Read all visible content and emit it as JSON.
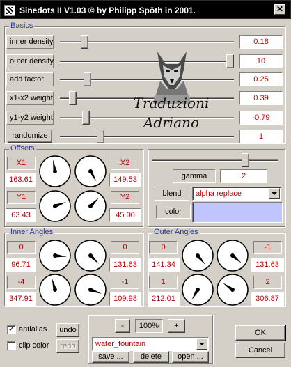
{
  "window": {
    "title": "Sinedots II V1.03 © by Philipp Spöth in 2001.",
    "close_glyph": "✕"
  },
  "logo": {
    "line1": "Traduzioni",
    "line2": "Adriano"
  },
  "basics": {
    "legend": "Basics",
    "rows": [
      {
        "label": "inner density",
        "value": "0.18",
        "level": 0.12
      },
      {
        "label": "outer density",
        "value": "10",
        "level": 1.0
      },
      {
        "label": "add factor",
        "value": "0.25",
        "level": 0.14
      },
      {
        "label": "x1-x2 weight",
        "value": "0.39",
        "level": 0.05
      },
      {
        "label": "y1-y2 weight",
        "value": "-0.79",
        "level": 0.13
      }
    ],
    "randomize_label": "randomize",
    "randomize_value": "1",
    "randomize_level": 0.22
  },
  "offsets": {
    "legend": "Offsets",
    "x1": {
      "label": "X1",
      "value": "163.61"
    },
    "x2": {
      "label": "X2",
      "value": "149.53"
    },
    "y1": {
      "label": "Y1",
      "value": "63.43"
    },
    "y2": {
      "label": "Y2",
      "value": "45.00"
    },
    "dials": [
      {
        "name": "x1-dial",
        "angle_deg": -10
      },
      {
        "name": "x2-dial",
        "angle_deg": 150
      },
      {
        "name": "y1-dial",
        "angle_deg": 70
      },
      {
        "name": "y2-dial",
        "angle_deg": 45
      }
    ]
  },
  "blending": {
    "gamma_label": "gamma",
    "gamma_value": "2",
    "gamma_level": 0.75,
    "blend_label": "blend",
    "blend_value": "alpha replace",
    "color_label": "color",
    "color_hex": "#c0c4ff"
  },
  "inner_angles": {
    "legend": "Inner Angles",
    "top_left": {
      "header": "0",
      "value": "96.71"
    },
    "top_right": {
      "header": "0",
      "value": "131.63"
    },
    "bottom_left": {
      "header": "-4",
      "value": "347.91"
    },
    "bottom_right": {
      "header": "-1",
      "value": "109.98"
    },
    "dials": [
      {
        "name": "inner-dial-1",
        "angle_deg": 95
      },
      {
        "name": "inner-dial-2",
        "angle_deg": 135
      },
      {
        "name": "inner-dial-3",
        "angle_deg": -15
      },
      {
        "name": "inner-dial-4",
        "angle_deg": 110
      }
    ]
  },
  "outer_angles": {
    "legend": "Outer Angles",
    "top_left": {
      "header": "0",
      "value": "141.34"
    },
    "top_right": {
      "header": "-1",
      "value": "131.63"
    },
    "bottom_left": {
      "header": "1",
      "value": "212.01"
    },
    "bottom_right": {
      "header": "2",
      "value": "306.87"
    },
    "dials": [
      {
        "name": "outer-dial-1",
        "angle_deg": 140
      },
      {
        "name": "outer-dial-2",
        "angle_deg": 130
      },
      {
        "name": "outer-dial-3",
        "angle_deg": 210
      },
      {
        "name": "outer-dial-4",
        "angle_deg": 305
      }
    ]
  },
  "options": {
    "antialias_label": "antialias",
    "antialias_mark": "✓",
    "clipcolor_label": "clip color",
    "undo_label": "undo",
    "redo_label": "redo"
  },
  "presets": {
    "minus_label": "-",
    "zoom": "100%",
    "plus_label": "+",
    "selected": "water_fountain",
    "save_label": "save ...",
    "delete_label": "delete",
    "open_label": "open ..."
  },
  "dialog": {
    "ok_label": "OK",
    "cancel_label": "Cancel"
  },
  "colors": {
    "value_text": "#c00000",
    "legend_text": "#2a3a9a",
    "face": "#d4d0c8"
  }
}
